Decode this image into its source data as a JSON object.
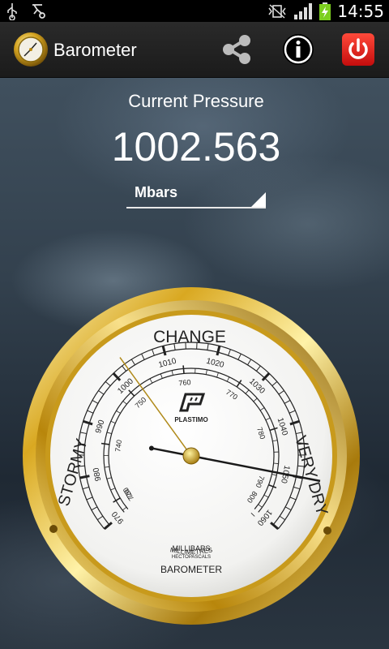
{
  "status_bar": {
    "time": "14:55"
  },
  "action_bar": {
    "title": "Barometer"
  },
  "main": {
    "label": "Current Pressure",
    "value": "1002.563",
    "unit": "Mbars"
  },
  "dial": {
    "top_word": "CHANGE",
    "left_word": "STORMY",
    "right_word": "VERY DRY",
    "brand": "PLASTIMO",
    "mm_label": "MILLIMETRES",
    "mb_label": "MILLIBARS",
    "hpa_label": "HECTOPASCALS",
    "bottom_label": "BAROMETER",
    "mbar_ticks": [
      "970",
      "980",
      "990",
      "1000",
      "1010",
      "1020",
      "1030",
      "1040",
      "1050",
      "1060"
    ],
    "mm_ticks": [
      "720",
      "730",
      "740",
      "750",
      "760",
      "770",
      "780",
      "790",
      "800"
    ],
    "pressure_mbar": 1002.563
  }
}
